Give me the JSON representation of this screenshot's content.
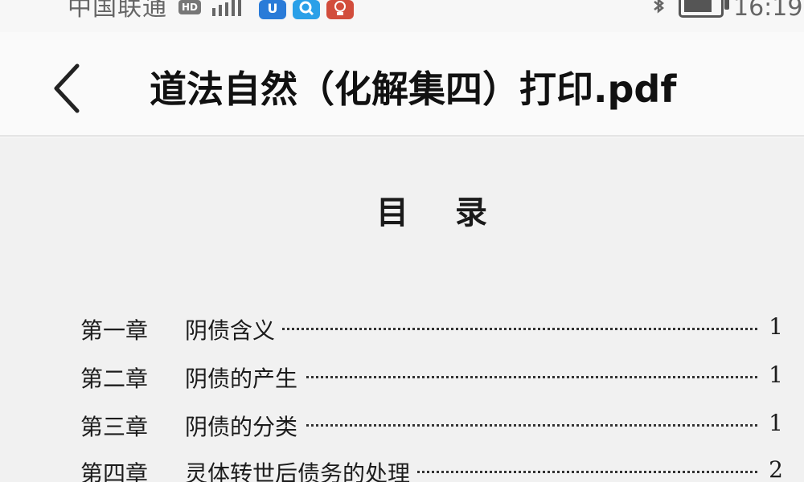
{
  "status_bar": {
    "carrier": "中国联通",
    "network_badge": "HD",
    "time": "16:19"
  },
  "header": {
    "back_icon": "chevron-left-icon",
    "title": "道法自然（化解集四）打印.pdf"
  },
  "document": {
    "toc_heading": "目录",
    "toc": [
      {
        "chapter": "第一章",
        "title": "阴债含义",
        "page": "1"
      },
      {
        "chapter": "第二章",
        "title": "阴债的产生",
        "page": "1"
      },
      {
        "chapter": "第三章",
        "title": "阴债的分类",
        "page": "1"
      },
      {
        "chapter": "第四章",
        "title": "灵体转世后债务的处理",
        "page": "2"
      }
    ]
  },
  "colors": {
    "page_bg": "#f1f1f1",
    "text": "#1a1a1a",
    "app_blue": "#2a7bd8",
    "app_red": "#d24d3c"
  }
}
